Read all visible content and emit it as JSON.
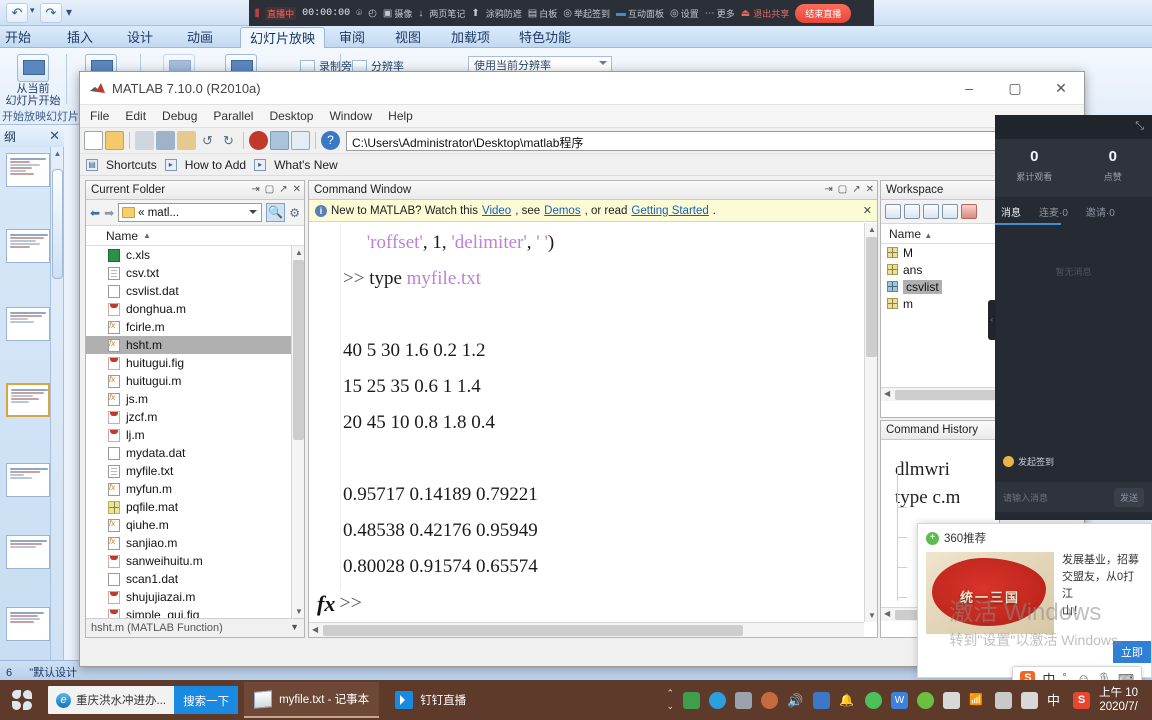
{
  "powerpoint": {
    "quick_access": {
      "undo": "↶",
      "redo": "↷",
      "more": "▾"
    },
    "tabs": [
      {
        "label": "开始",
        "active": false
      },
      {
        "label": "插入",
        "active": false
      },
      {
        "label": "设计",
        "active": false
      },
      {
        "label": "动画",
        "active": false
      },
      {
        "label": "幻灯片放映",
        "active": true
      },
      {
        "label": "审阅",
        "active": false
      },
      {
        "label": "视图",
        "active": false
      },
      {
        "label": "加载项",
        "active": false
      },
      {
        "label": "特色功能",
        "active": false
      }
    ],
    "ribbon": {
      "from_current": "从当前\n幻灯片开始",
      "group_start": "开始放映幻灯片",
      "record_narration": "录制旁白",
      "resolution_label": "分辨率",
      "resolution_value": "使用当前分辨率"
    },
    "slide_pane": {
      "tab_label": "纲",
      "close": "✕",
      "slide_count": 7,
      "selected_index": 3
    },
    "status_bar": {
      "slide_number": "6",
      "theme": "\"默认设计"
    }
  },
  "recording_toolbar": {
    "app_tag": "直播中",
    "timer": "00:00:00",
    "items": [
      {
        "icon": "wifi-icon",
        "label": ""
      },
      {
        "icon": "screen-share-icon",
        "label": ""
      },
      {
        "icon": "camera-icon",
        "label": "摄像"
      },
      {
        "icon": "mic-icon",
        "label": ""
      },
      {
        "icon": "note-icon",
        "label": "两页笔记"
      },
      {
        "icon": "upload-icon",
        "label": ""
      },
      {
        "icon": "paint-icon",
        "label": "涂鸦防遮"
      },
      {
        "icon": "board-icon",
        "label": "白板"
      },
      {
        "icon": "location-icon",
        "label": "举起签到"
      },
      {
        "icon": "chat-icon",
        "label": "互动面板"
      },
      {
        "icon": "settings-icon",
        "label": "设置"
      },
      {
        "icon": "more-icon",
        "label": "更多"
      }
    ],
    "exit_label": "退出共享",
    "live_label": "结束直播"
  },
  "matlab": {
    "title": "MATLAB 7.10.0 (R2010a)",
    "window_buttons": {
      "minimize": "–",
      "maximize": "▢",
      "close": "✕"
    },
    "menus": [
      "File",
      "Edit",
      "Debug",
      "Parallel",
      "Desktop",
      "Window",
      "Help"
    ],
    "path": "C:\\Users\\Administrator\\Desktop\\matlab程序",
    "path_browse": "...",
    "shortcuts_bar": {
      "shortcuts": "Shortcuts",
      "how_to_add": "How to Add",
      "whats_new": "What's New"
    },
    "current_folder": {
      "title": "Current Folder",
      "path_combo": "« matl...",
      "column_header": "Name",
      "status": "hsht.m (MATLAB Function)",
      "files": [
        {
          "name": "c.xls",
          "type": "xls",
          "selected": false
        },
        {
          "name": "csv.txt",
          "type": "txt",
          "selected": false
        },
        {
          "name": "csvlist.dat",
          "type": "dat",
          "selected": false
        },
        {
          "name": "donghua.m",
          "type": "m",
          "selected": false
        },
        {
          "name": "fcirle.m",
          "type": "fx",
          "selected": false
        },
        {
          "name": "hsht.m",
          "type": "fx",
          "selected": true
        },
        {
          "name": "huitugui.fig",
          "type": "m",
          "selected": false
        },
        {
          "name": "huitugui.m",
          "type": "fx",
          "selected": false
        },
        {
          "name": "js.m",
          "type": "fx",
          "selected": false
        },
        {
          "name": "jzcf.m",
          "type": "m",
          "selected": false
        },
        {
          "name": "lj.m",
          "type": "m",
          "selected": false
        },
        {
          "name": "mydata.dat",
          "type": "dat",
          "selected": false
        },
        {
          "name": "myfile.txt",
          "type": "txt",
          "selected": false
        },
        {
          "name": "myfun.m",
          "type": "fx",
          "selected": false
        },
        {
          "name": "pqfile.mat",
          "type": "mat",
          "selected": false
        },
        {
          "name": "qiuhe.m",
          "type": "fx",
          "selected": false
        },
        {
          "name": "sanjiao.m",
          "type": "fx",
          "selected": false
        },
        {
          "name": "sanweihuitu.m",
          "type": "m",
          "selected": false
        },
        {
          "name": "scan1.dat",
          "type": "dat",
          "selected": false
        },
        {
          "name": "shujujiazai.m",
          "type": "m",
          "selected": false
        },
        {
          "name": "simple_gui.fig",
          "type": "m",
          "selected": false
        }
      ]
    },
    "command_window": {
      "title": "Command Window",
      "notice": {
        "prefix": "New to MATLAB? Watch this ",
        "link1": "Video",
        "mid1": ", see ",
        "link2": "Demos",
        "mid2": ", or read ",
        "link3": "Getting Started",
        "suffix": "."
      },
      "lines": [
        "     'roffset', 1, 'delimiter', ' ')",
        ">> type myfile.txt",
        "",
        "40 5 30 1.6 0.2 1.2",
        "15 25 35 0.6 1 1.4",
        "20 45 10 0.8 1.8 0.4",
        "",
        "0.95717 0.14189 0.79221",
        "0.48538 0.42176 0.95949",
        "0.80028 0.91574 0.65574"
      ],
      "prompt": ">>",
      "fx_glyph": "fx"
    },
    "workspace": {
      "title": "Workspace",
      "column_header": "Name",
      "variables": [
        {
          "name": "M",
          "selected": false,
          "kind": "matrix"
        },
        {
          "name": "ans",
          "selected": false,
          "kind": "matrix"
        },
        {
          "name": "csvlist",
          "selected": true,
          "kind": "cell"
        },
        {
          "name": "m",
          "selected": false,
          "kind": "matrix"
        }
      ]
    },
    "command_history": {
      "title": "Command History",
      "line1": "dlmwri",
      "line2": "type c.m"
    }
  },
  "dingtalk": {
    "stats": [
      {
        "value": "0",
        "label": "累计观看"
      },
      {
        "value": "0",
        "label": "点赞"
      }
    ],
    "tabs": [
      {
        "label": "消息",
        "active": true
      },
      {
        "label": "连麦·0",
        "active": false
      },
      {
        "label": "邀请·0",
        "active": false
      }
    ],
    "empty_text": "暂无消息",
    "checkin_label": "发起签到",
    "input_placeholder": "请输入消息",
    "send_label": "发送",
    "collapse_icon": "⤡",
    "side_handle": "‹"
  },
  "ad": {
    "source": "360推荐",
    "image_caption": "统一三国",
    "copy": "发展基业，招募\n交盟友，从0打江\n山！",
    "cta": "立即"
  },
  "watermark": {
    "line1": "激活 Windows",
    "line2": "转到\"设置\"以激活 Windows。"
  },
  "ime": {
    "logo": "S",
    "mode": "中",
    "punct": "°,",
    "emoji": "☺",
    "mic": "🎤",
    "keyboard": "⌨"
  },
  "taskbar": {
    "search": {
      "icon": "ie-icon",
      "text": "重庆洪水冲进办...",
      "button": "搜索一下"
    },
    "tasks": [
      {
        "icon": "notepad-icon",
        "label": "myfile.txt - 记事本",
        "active": true
      },
      {
        "icon": "dingtalk-icon",
        "label": "钉钉直播",
        "active": false
      }
    ],
    "tray_icons": [
      {
        "name": "usb-icon",
        "color": "#3f9e4d"
      },
      {
        "name": "telegram-icon",
        "color": "#2b9fe0"
      },
      {
        "name": "device-icon",
        "color": "#9aa3ad"
      },
      {
        "name": "user-icon",
        "color": "#c76a3e"
      },
      {
        "name": "volume-icon",
        "color": "#e8e8e8"
      },
      {
        "name": "security-icon",
        "color": "#3c78c8"
      },
      {
        "name": "bell-icon",
        "color": "#f0f0f0"
      },
      {
        "name": "wechat-icon",
        "color": "#4ec05a"
      },
      {
        "name": "wps-icon",
        "color": "#3b82e0"
      },
      {
        "name": "360-icon",
        "color": "#6dbf3f"
      },
      {
        "name": "battery-icon",
        "color": "#d8d8d8"
      },
      {
        "name": "network-icon",
        "color": "#dcdcdc"
      },
      {
        "name": "printer-icon",
        "color": "#c9c9c9"
      },
      {
        "name": "keyboard-icon",
        "color": "#d8d8d8"
      },
      {
        "name": "ime-cn-icon",
        "color": "#ffffff"
      },
      {
        "name": "sogou-icon",
        "color": "#e8472f"
      }
    ],
    "clock": {
      "time": "上午 10",
      "date": "2020/7/"
    }
  }
}
